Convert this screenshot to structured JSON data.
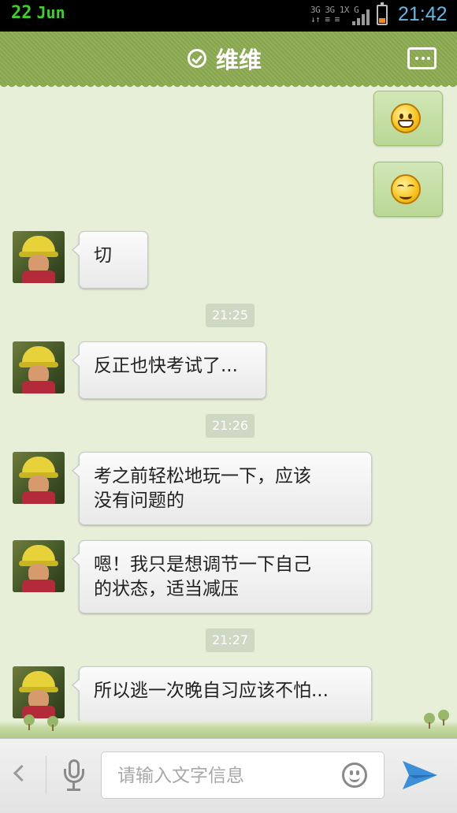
{
  "status_bar": {
    "day": "22",
    "month": "Jun",
    "network_line1": "3G 3G 1X G",
    "network_line2": "↓↑ ≡ ≡",
    "time": "21:42",
    "battery_level": 0.3,
    "colors": {
      "date": "#3bd128",
      "time": "#5fb8e8",
      "battery": "#f08c1a"
    }
  },
  "header": {
    "title": "维维",
    "online_icon": "check-circle-icon",
    "more_icon": "more-dots-icon",
    "color": "#8cab51"
  },
  "messages": [
    {
      "side": "right",
      "type": "emoji",
      "emoji": "grin-emoji"
    },
    {
      "side": "right",
      "type": "emoji",
      "emoji": "smirk-wink-emoji"
    },
    {
      "side": "left",
      "type": "text",
      "text": "切"
    },
    {
      "type": "time",
      "text": "21:25"
    },
    {
      "side": "left",
      "type": "text",
      "text": "反正也快考试了..."
    },
    {
      "type": "time",
      "text": "21:26"
    },
    {
      "side": "left",
      "type": "text",
      "text": "考之前轻松地玩一下，应该\n没有问题的"
    },
    {
      "side": "left",
      "type": "text",
      "text": "嗯！我只是想调节一下自己\n的状态，适当减压"
    },
    {
      "type": "time",
      "text": "21:27"
    },
    {
      "side": "left",
      "type": "text",
      "text": "所以逃一次晚自习应该不怕..."
    }
  ],
  "input_bar": {
    "back_icon": "chevron-left-icon",
    "voice_icon": "microphone-icon",
    "placeholder": "请输入文字信息",
    "value": "",
    "emoji_icon": "smiley-icon",
    "send_icon": "send-paper-plane-icon",
    "send_color": "#3a8fd8"
  }
}
